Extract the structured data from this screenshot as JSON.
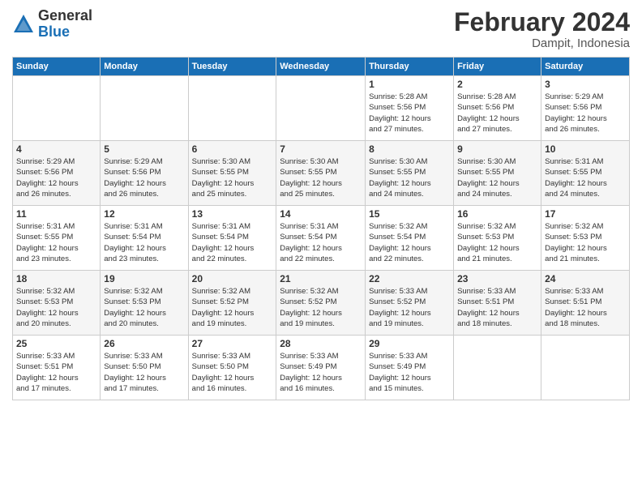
{
  "logo": {
    "general": "General",
    "blue": "Blue"
  },
  "title": {
    "month": "February 2024",
    "location": "Dampit, Indonesia"
  },
  "weekdays": [
    "Sunday",
    "Monday",
    "Tuesday",
    "Wednesday",
    "Thursday",
    "Friday",
    "Saturday"
  ],
  "weeks": [
    [
      {
        "day": "",
        "detail": ""
      },
      {
        "day": "",
        "detail": ""
      },
      {
        "day": "",
        "detail": ""
      },
      {
        "day": "",
        "detail": ""
      },
      {
        "day": "1",
        "detail": "Sunrise: 5:28 AM\nSunset: 5:56 PM\nDaylight: 12 hours\nand 27 minutes."
      },
      {
        "day": "2",
        "detail": "Sunrise: 5:28 AM\nSunset: 5:56 PM\nDaylight: 12 hours\nand 27 minutes."
      },
      {
        "day": "3",
        "detail": "Sunrise: 5:29 AM\nSunset: 5:56 PM\nDaylight: 12 hours\nand 26 minutes."
      }
    ],
    [
      {
        "day": "4",
        "detail": "Sunrise: 5:29 AM\nSunset: 5:56 PM\nDaylight: 12 hours\nand 26 minutes."
      },
      {
        "day": "5",
        "detail": "Sunrise: 5:29 AM\nSunset: 5:56 PM\nDaylight: 12 hours\nand 26 minutes."
      },
      {
        "day": "6",
        "detail": "Sunrise: 5:30 AM\nSunset: 5:55 PM\nDaylight: 12 hours\nand 25 minutes."
      },
      {
        "day": "7",
        "detail": "Sunrise: 5:30 AM\nSunset: 5:55 PM\nDaylight: 12 hours\nand 25 minutes."
      },
      {
        "day": "8",
        "detail": "Sunrise: 5:30 AM\nSunset: 5:55 PM\nDaylight: 12 hours\nand 24 minutes."
      },
      {
        "day": "9",
        "detail": "Sunrise: 5:30 AM\nSunset: 5:55 PM\nDaylight: 12 hours\nand 24 minutes."
      },
      {
        "day": "10",
        "detail": "Sunrise: 5:31 AM\nSunset: 5:55 PM\nDaylight: 12 hours\nand 24 minutes."
      }
    ],
    [
      {
        "day": "11",
        "detail": "Sunrise: 5:31 AM\nSunset: 5:55 PM\nDaylight: 12 hours\nand 23 minutes."
      },
      {
        "day": "12",
        "detail": "Sunrise: 5:31 AM\nSunset: 5:54 PM\nDaylight: 12 hours\nand 23 minutes."
      },
      {
        "day": "13",
        "detail": "Sunrise: 5:31 AM\nSunset: 5:54 PM\nDaylight: 12 hours\nand 22 minutes."
      },
      {
        "day": "14",
        "detail": "Sunrise: 5:31 AM\nSunset: 5:54 PM\nDaylight: 12 hours\nand 22 minutes."
      },
      {
        "day": "15",
        "detail": "Sunrise: 5:32 AM\nSunset: 5:54 PM\nDaylight: 12 hours\nand 22 minutes."
      },
      {
        "day": "16",
        "detail": "Sunrise: 5:32 AM\nSunset: 5:53 PM\nDaylight: 12 hours\nand 21 minutes."
      },
      {
        "day": "17",
        "detail": "Sunrise: 5:32 AM\nSunset: 5:53 PM\nDaylight: 12 hours\nand 21 minutes."
      }
    ],
    [
      {
        "day": "18",
        "detail": "Sunrise: 5:32 AM\nSunset: 5:53 PM\nDaylight: 12 hours\nand 20 minutes."
      },
      {
        "day": "19",
        "detail": "Sunrise: 5:32 AM\nSunset: 5:53 PM\nDaylight: 12 hours\nand 20 minutes."
      },
      {
        "day": "20",
        "detail": "Sunrise: 5:32 AM\nSunset: 5:52 PM\nDaylight: 12 hours\nand 19 minutes."
      },
      {
        "day": "21",
        "detail": "Sunrise: 5:32 AM\nSunset: 5:52 PM\nDaylight: 12 hours\nand 19 minutes."
      },
      {
        "day": "22",
        "detail": "Sunrise: 5:33 AM\nSunset: 5:52 PM\nDaylight: 12 hours\nand 19 minutes."
      },
      {
        "day": "23",
        "detail": "Sunrise: 5:33 AM\nSunset: 5:51 PM\nDaylight: 12 hours\nand 18 minutes."
      },
      {
        "day": "24",
        "detail": "Sunrise: 5:33 AM\nSunset: 5:51 PM\nDaylight: 12 hours\nand 18 minutes."
      }
    ],
    [
      {
        "day": "25",
        "detail": "Sunrise: 5:33 AM\nSunset: 5:51 PM\nDaylight: 12 hours\nand 17 minutes."
      },
      {
        "day": "26",
        "detail": "Sunrise: 5:33 AM\nSunset: 5:50 PM\nDaylight: 12 hours\nand 17 minutes."
      },
      {
        "day": "27",
        "detail": "Sunrise: 5:33 AM\nSunset: 5:50 PM\nDaylight: 12 hours\nand 16 minutes."
      },
      {
        "day": "28",
        "detail": "Sunrise: 5:33 AM\nSunset: 5:49 PM\nDaylight: 12 hours\nand 16 minutes."
      },
      {
        "day": "29",
        "detail": "Sunrise: 5:33 AM\nSunset: 5:49 PM\nDaylight: 12 hours\nand 15 minutes."
      },
      {
        "day": "",
        "detail": ""
      },
      {
        "day": "",
        "detail": ""
      }
    ]
  ]
}
